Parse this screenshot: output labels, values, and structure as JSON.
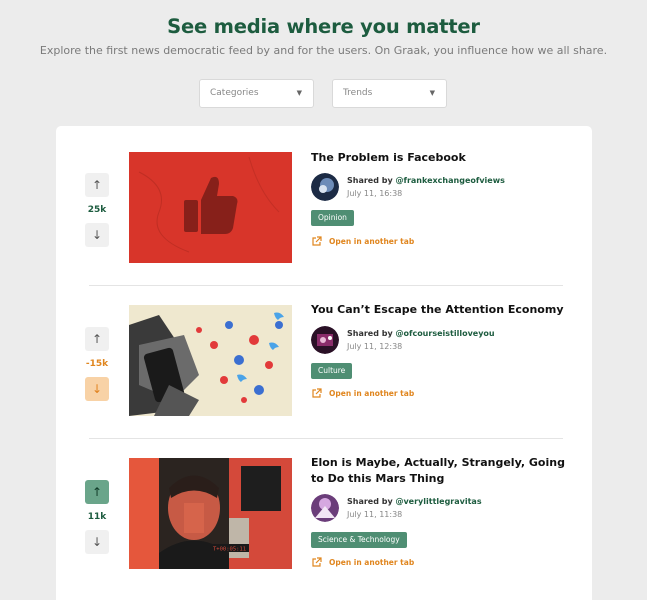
{
  "hero": {
    "title": "See media where you matter",
    "subtitle": "Explore the first news democratic feed by and for the users. On Graak, you influence how we all share."
  },
  "filters": {
    "categories_label": "Categories",
    "trends_label": "Trends"
  },
  "posts": [
    {
      "title": "The Problem is Facebook",
      "shared_prefix": "Shared by ",
      "handle": "@frankexchangeofviews",
      "date": "July 11, 16:38",
      "tag": "Opinion",
      "open_label": "Open in another tab",
      "votes": "25k",
      "vote_state": "none"
    },
    {
      "title": "You Can’t Escape the Attention Economy",
      "shared_prefix": "Shared by ",
      "handle": "@ofcourseistilloveyou",
      "date": "July 11, 12:38",
      "tag": "Culture",
      "open_label": "Open in another tab",
      "votes": "-15k",
      "vote_state": "down"
    },
    {
      "title": "Elon is Maybe, Actually, Strangely, Going to Do this Mars Thing",
      "shared_prefix": "Shared by ",
      "handle": "@verylittlegravitas",
      "date": "July 11, 11:38",
      "tag": "Science & Technology",
      "open_label": "Open in another tab",
      "votes": "11k",
      "vote_state": "up",
      "thumb_caption": "T+00:05:11"
    }
  ],
  "icons": {
    "caret": "caret-down-icon",
    "upvote": "arrow-up-icon",
    "downvote": "arrow-down-icon",
    "external": "external-link-icon"
  },
  "colors": {
    "brand_green": "#1d5c3f",
    "tag_green": "#4f8e73",
    "accent_orange": "#e0861f",
    "background": "#ececec"
  }
}
